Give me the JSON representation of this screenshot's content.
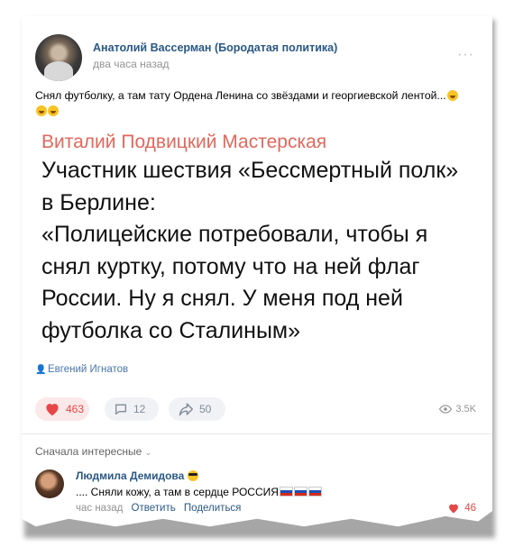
{
  "post": {
    "author": "Анатолий Вассерман (Бородатая политика)",
    "time": "два часа назад",
    "more": "···",
    "caption": "Снял футболку, а там тату Ордена Ленина со звёздами и георгиевской лентой...",
    "quote_source": "Виталий Подвицкий Мастерская",
    "quote_text": "Участник шествия «Бессмертный полк» в Берлине:\n«Полицейские потребовали, чтобы я снял куртку, потому что на ней флаг России. Ну я снял. У меня под ней футболка со Сталиным»",
    "credit": "Евгений Игнатов",
    "likes": "463",
    "comments": "12",
    "shares": "50",
    "views": "3.5K"
  },
  "comments_section": {
    "sort_label": "Сначала интересные",
    "comment": {
      "author": "Людмила Демидова",
      "text": ".... Сняли кожу, а там в сердце РОССИЯ",
      "time": "час назад",
      "reply": "Ответить",
      "share": "Поделиться",
      "likes": "46"
    }
  },
  "colors": {
    "link": "#2a5885",
    "like": "#e64646",
    "quote_source": "#e0685c"
  }
}
